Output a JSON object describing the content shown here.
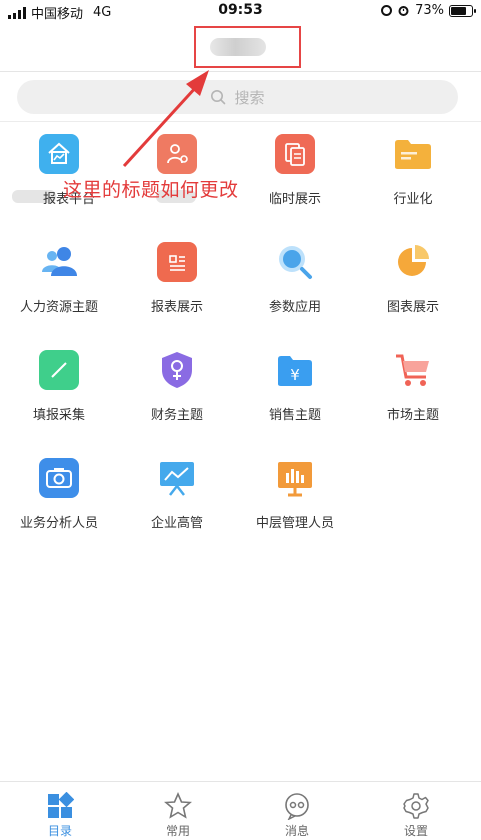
{
  "status_bar": {
    "carrier": "中国移动",
    "network": "4G",
    "time": "09:53",
    "battery": "73%"
  },
  "search": {
    "placeholder": "搜索"
  },
  "grid": {
    "items": [
      {
        "label": "报表平台",
        "icon": "house-chart-icon",
        "color": "#3fb0ee"
      },
      {
        "label": "",
        "icon": "user-gear-icon",
        "color": "#ef7a62"
      },
      {
        "label": "临时展示",
        "icon": "documents-icon",
        "color": "#ef6a55"
      },
      {
        "label": "行业化",
        "icon": "folder-icon",
        "color": "#f4b13c"
      },
      {
        "label": "人力资源主题",
        "icon": "people-icon",
        "color": "#4a96ea"
      },
      {
        "label": "报表展示",
        "icon": "report-icon",
        "color": "#ef6a4f"
      },
      {
        "label": "参数应用",
        "icon": "magnifier-icon",
        "color": "#4aa4ea"
      },
      {
        "label": "图表展示",
        "icon": "pie-chart-icon",
        "color": "#f5a83a"
      },
      {
        "label": "填报采集",
        "icon": "edit-square-icon",
        "color": "#3fcf8b"
      },
      {
        "label": "财务主题",
        "icon": "shield-icon",
        "color": "#8a6be3"
      },
      {
        "label": "销售主题",
        "icon": "yen-folder-icon",
        "color": "#3a9ef0"
      },
      {
        "label": "市场主题",
        "icon": "cart-icon",
        "color": "#f06356"
      },
      {
        "label": "业务分析人员",
        "icon": "camera-icon",
        "color": "#3e8ee9"
      },
      {
        "label": "企业高管",
        "icon": "presentation-icon",
        "color": "#45a9ec"
      },
      {
        "label": "中层管理人员",
        "icon": "bar-board-icon",
        "color": "#f29a3a"
      }
    ]
  },
  "annotation": {
    "text": "这里的标题如何更改",
    "color": "#e33b3b"
  },
  "tabbar": {
    "tabs": [
      {
        "label": "目录",
        "icon": "catalog-icon",
        "active": true
      },
      {
        "label": "常用",
        "icon": "star-icon",
        "active": false
      },
      {
        "label": "消息",
        "icon": "message-icon",
        "active": false
      },
      {
        "label": "设置",
        "icon": "gear-icon",
        "active": false
      }
    ],
    "accent": "#3a8fe0"
  }
}
